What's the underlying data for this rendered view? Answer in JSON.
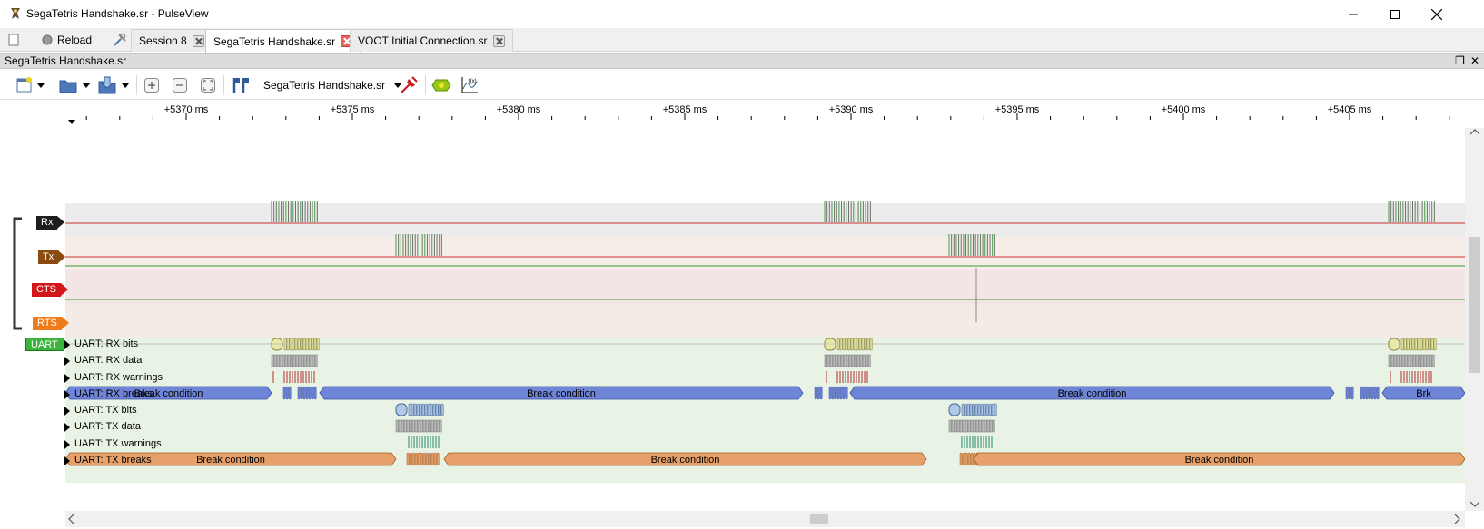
{
  "window": {
    "title": "SegaTetris Handshake.sr - PulseView",
    "minimize_icon": "minimize-icon",
    "maximize_icon": "maximize-icon",
    "close_icon": "close-icon"
  },
  "tabbar": {
    "reload_label": "Reload",
    "tabs": [
      {
        "label": "Session 8",
        "active": false
      },
      {
        "label": "SegaTetris Handshake.sr",
        "active": true
      },
      {
        "label": "VOOT Initial Connection.sr",
        "active": false
      }
    ]
  },
  "session": {
    "title": "SegaTetris Handshake.sr"
  },
  "toolbar": {
    "device": "SegaTetris Handshake.sr"
  },
  "ruler": {
    "labels": [
      "+5370 ms",
      "+5375 ms",
      "+5380 ms",
      "+5385 ms",
      "+5390 ms",
      "+5395 ms",
      "+5400 ms",
      "+5405 ms"
    ]
  },
  "signals": [
    {
      "name": "Rx",
      "color": "#1e1e1e"
    },
    {
      "name": "Tx",
      "color": "#8b4a0f"
    },
    {
      "name": "CTS",
      "color": "#d2171b"
    },
    {
      "name": "RTS",
      "color": "#f07b1a"
    }
  ],
  "decoder": {
    "name": "UART",
    "color": "#3cb43c",
    "rows": [
      "UART: RX bits",
      "UART: RX data",
      "UART: RX warnings",
      "UART: RX breaks",
      "UART: TX bits",
      "UART: TX data",
      "UART: TX warnings",
      "UART: TX breaks"
    ],
    "break_label": "Break condition",
    "break_short": "Brk"
  },
  "colors": {
    "rx_break": "#6f86d8",
    "tx_break": "#e8a06a",
    "decoder_bg": "#e8f3e5",
    "rx_trace": "#c83232",
    "cts_trace": "#32a032"
  }
}
